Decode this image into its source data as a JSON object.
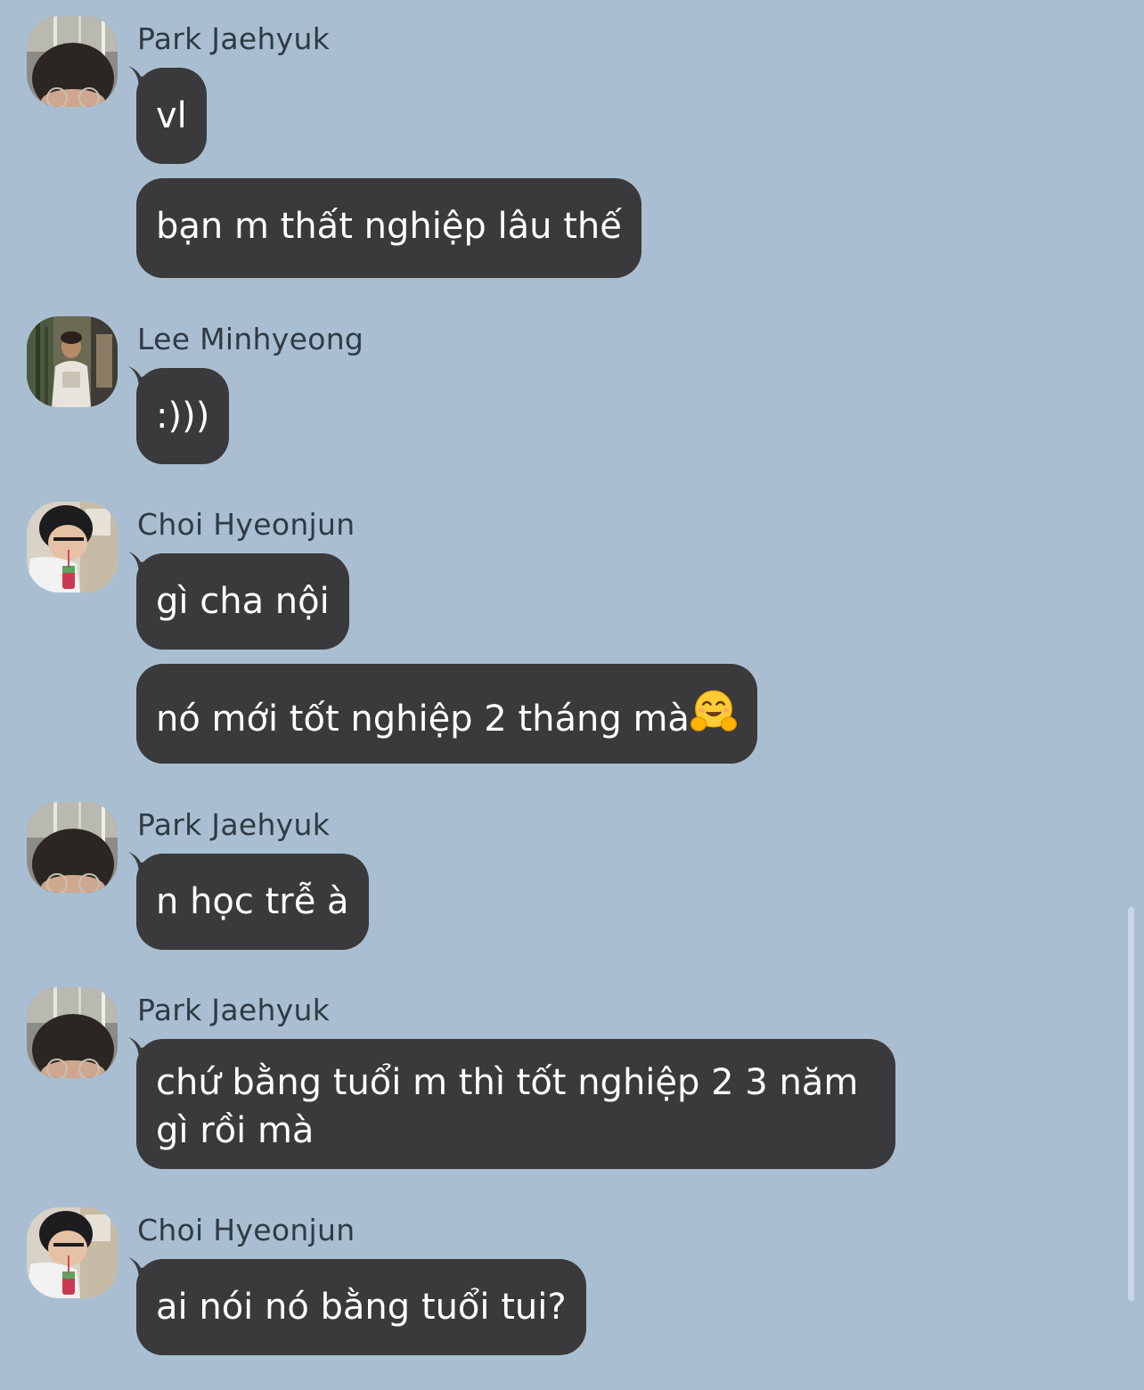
{
  "colors": {
    "background": "#a9bfd1",
    "bubble": "#3a3a3c",
    "bubble_text": "#ffffff",
    "sender_text": "#2f3a44"
  },
  "groups": [
    {
      "sender": "Park Jaehyuk",
      "avatar": "avatar-park-jaehyuk",
      "messages": [
        "vl",
        "bạn m thất nghiệp lâu thế"
      ]
    },
    {
      "sender": "Lee Minhyeong",
      "avatar": "avatar-lee-minhyeong",
      "messages": [
        ":)))"
      ]
    },
    {
      "sender": "Choi Hyeonjun",
      "avatar": "avatar-choi-hyeonjun",
      "messages": [
        "gì cha nội",
        "nó mới tốt nghiệp 2 tháng mà"
      ],
      "emoji": "hugging-face-emoji"
    },
    {
      "sender": "Park Jaehyuk",
      "avatar": "avatar-park-jaehyuk",
      "messages": [
        "n học trễ à"
      ]
    },
    {
      "sender": "Park Jaehyuk",
      "avatar": "avatar-park-jaehyuk",
      "messages": [
        "chứ bằng tuổi m thì tốt nghiệp 2 3 năm gì rồi mà"
      ]
    },
    {
      "sender": "Choi Hyeonjun",
      "avatar": "avatar-choi-hyeonjun",
      "messages": [
        "ai nói nó bằng tuổi tui?"
      ]
    }
  ]
}
